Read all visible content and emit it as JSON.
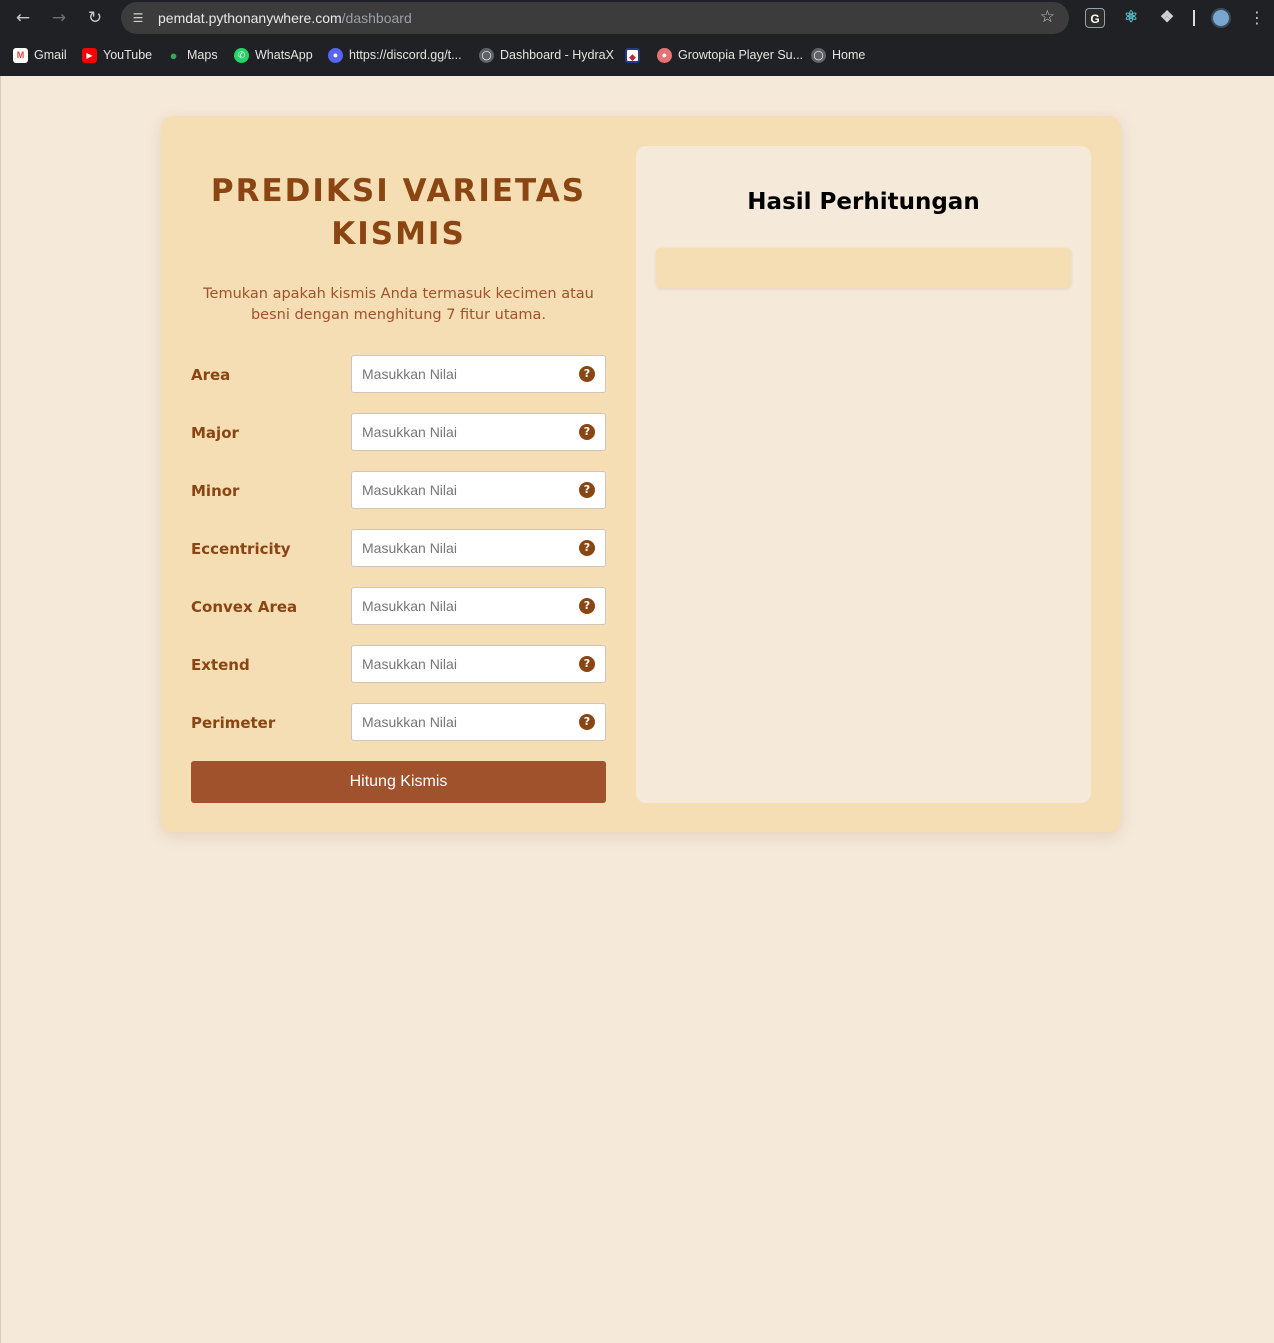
{
  "browser": {
    "url_host": "pemdat.pythonanywhere.com",
    "url_path": "/dashboard",
    "bookmarks": [
      {
        "label": "Gmail",
        "icon": "gmail-icon"
      },
      {
        "label": "YouTube",
        "icon": "youtube-icon"
      },
      {
        "label": "Maps",
        "icon": "maps-icon"
      },
      {
        "label": "WhatsApp",
        "icon": "whatsapp-icon"
      },
      {
        "label": "https://discord.gg/t...",
        "icon": "discord-icon"
      },
      {
        "label": "Dashboard - HydraX",
        "icon": "globe-icon"
      },
      {
        "label": "",
        "icon": "shield-badge-icon"
      },
      {
        "label": "Growtopia Player Su...",
        "icon": "growtopia-icon"
      },
      {
        "label": "Home",
        "icon": "globe-icon"
      }
    ]
  },
  "form": {
    "title": "PREDIKSI VARIETAS KISMIS",
    "subtitle": "Temukan apakah kismis Anda termasuk kecimen atau besni dengan menghitung 7 fitur utama.",
    "placeholder": "Masukkan Nilai",
    "fields": [
      {
        "label": "Area",
        "value": ""
      },
      {
        "label": "Major",
        "value": ""
      },
      {
        "label": "Minor",
        "value": ""
      },
      {
        "label": "Eccentricity",
        "value": ""
      },
      {
        "label": "Convex Area",
        "value": ""
      },
      {
        "label": "Extend",
        "value": ""
      },
      {
        "label": "Perimeter",
        "value": ""
      }
    ],
    "submit_label": "Hitung Kismis"
  },
  "result": {
    "title": "Hasil Perhitungan",
    "value": ""
  },
  "colors": {
    "page_bg": "#f5e9da",
    "card_bg": "#f5deb3",
    "heading": "#8b4513",
    "subtitle": "#a0522d",
    "button": "#a0522d"
  }
}
